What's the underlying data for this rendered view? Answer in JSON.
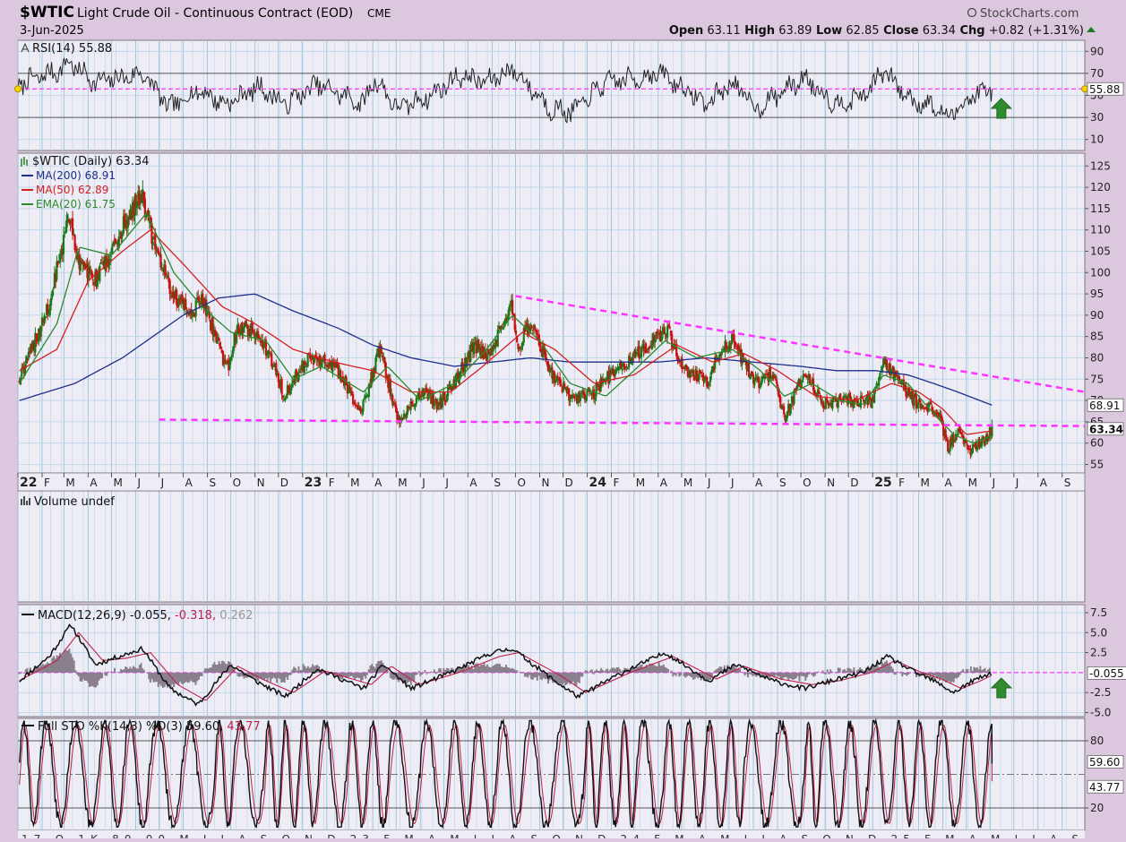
{
  "header": {
    "symbol": "$WTIC",
    "name": "Light Crude Oil - Continuous Contract (EOD)",
    "exchange": "CME",
    "date": "3-Jun-2025",
    "brand": "StockCharts.com",
    "ohlc": [
      {
        "label": "Open",
        "value": "63.11"
      },
      {
        "label": "High",
        "value": "63.89"
      },
      {
        "label": "Low",
        "value": "62.85"
      },
      {
        "label": "Close",
        "value": "63.34"
      },
      {
        "label": "Chg",
        "value": "+0.82 (+1.31%)"
      }
    ]
  },
  "colors": {
    "background": "#dcc8de",
    "plot": "#eeedf6",
    "grid": "#b9d3e6",
    "up": "#1a7a1a",
    "down": "#cc1010",
    "ma200": "#1f2f8a",
    "ma50": "#d42020",
    "ema20": "#2a8a2a",
    "trendline": "#ff33ff",
    "arrow": "#2e8b2e"
  },
  "chart_data": [
    {
      "type": "line",
      "panel": "rsi",
      "title": "RSI(14) 55.88",
      "indicator": "RSI(14)",
      "last_value": 55.88,
      "last_label": "55.88",
      "ylim": [
        0,
        100
      ],
      "yticks": [
        90,
        70,
        50,
        30,
        10
      ],
      "overbought": 70,
      "oversold": 30,
      "reference_line": 55.88,
      "x_range": [
        "2022-01-01",
        "2025-09-30"
      ],
      "x": [
        "2022-01-01",
        "2022-02-20",
        "2022-03-08",
        "2022-04-10",
        "2022-05-15",
        "2022-06-10",
        "2022-07-15",
        "2022-08-20",
        "2022-09-25",
        "2022-11-05",
        "2022-12-10",
        "2023-01-20",
        "2023-03-20",
        "2023-04-03",
        "2023-05-04",
        "2023-06-15",
        "2023-07-20",
        "2023-08-25",
        "2023-09-27",
        "2023-11-15",
        "2023-12-13",
        "2024-01-25",
        "2024-03-10",
        "2024-04-05",
        "2024-06-01",
        "2024-07-05",
        "2024-08-05",
        "2024-09-10",
        "2024-10-07",
        "2024-11-15",
        "2024-12-20",
        "2025-01-15",
        "2025-02-20",
        "2025-03-15",
        "2025-04-08",
        "2025-05-05",
        "2025-06-03"
      ],
      "values": [
        60,
        72,
        80,
        62,
        66,
        70,
        38,
        55,
        42,
        58,
        42,
        60,
        42,
        65,
        38,
        50,
        68,
        62,
        74,
        38,
        35,
        62,
        66,
        70,
        42,
        62,
        38,
        55,
        66,
        42,
        50,
        72,
        45,
        42,
        30,
        48,
        55.88
      ]
    },
    {
      "type": "line",
      "panel": "price",
      "title": "$WTIC (Daily) 63.34",
      "legend": [
        {
          "name": "$WTIC (Daily) 63.34",
          "color": "#1a7a1a"
        },
        {
          "name": "MA(200) 68.91",
          "color": "#1f2f8a"
        },
        {
          "name": "MA(50) 62.89",
          "color": "#d42020"
        },
        {
          "name": "EMA(20) 61.75",
          "color": "#2a8a2a"
        }
      ],
      "ylim": [
        53,
        128
      ],
      "yticks": [
        125,
        120,
        115,
        110,
        105,
        100,
        95,
        90,
        85,
        80,
        75,
        70,
        65,
        60,
        55
      ],
      "x_range": [
        "2022-01-01",
        "2025-09-30"
      ],
      "last_close": 63.34,
      "series": [
        {
          "name": "$WTIC (Daily) 63.34",
          "x": [
            "2022-01-03",
            "2022-02-10",
            "2022-03-08",
            "2022-03-20",
            "2022-04-10",
            "2022-04-25",
            "2022-05-20",
            "2022-06-08",
            "2022-06-25",
            "2022-07-15",
            "2022-08-10",
            "2022-08-25",
            "2022-09-26",
            "2022-10-10",
            "2022-11-08",
            "2022-11-28",
            "2022-12-09",
            "2023-01-05",
            "2023-01-25",
            "2023-02-20",
            "2023-03-17",
            "2023-04-10",
            "2023-05-04",
            "2023-06-05",
            "2023-06-25",
            "2023-07-20",
            "2023-08-10",
            "2023-08-25",
            "2023-09-27",
            "2023-10-05",
            "2023-10-20",
            "2023-11-15",
            "2023-12-12",
            "2024-01-10",
            "2024-02-05",
            "2024-03-01",
            "2024-03-25",
            "2024-04-12",
            "2024-05-02",
            "2024-06-03",
            "2024-06-20",
            "2024-07-05",
            "2024-08-05",
            "2024-08-25",
            "2024-09-10",
            "2024-10-07",
            "2024-10-28",
            "2024-11-15",
            "2024-12-10",
            "2024-12-31",
            "2025-01-15",
            "2025-02-10",
            "2025-03-05",
            "2025-03-25",
            "2025-04-08",
            "2025-04-20",
            "2025-05-05",
            "2025-05-20",
            "2025-06-03"
          ],
          "values": [
            75,
            92,
            114,
            102,
            98,
            103,
            112,
            119,
            106,
            96,
            90,
            94,
            77,
            88,
            85,
            77,
            71,
            79,
            80,
            76,
            67,
            82,
            65,
            72,
            69,
            76,
            83,
            80,
            92,
            83,
            88,
            77,
            70,
            72,
            77,
            80,
            84,
            87,
            78,
            74,
            82,
            84,
            74,
            77,
            66,
            77,
            69,
            70,
            70,
            70,
            79,
            73,
            68,
            68,
            59,
            63,
            58,
            60,
            63.34
          ]
        },
        {
          "name": "MA(200) 68.91",
          "x": [
            "2022-01-03",
            "2022-03-15",
            "2022-05-15",
            "2022-08-01",
            "2022-09-15",
            "2022-11-01",
            "2022-12-20",
            "2023-02-15",
            "2023-04-01",
            "2023-05-20",
            "2023-07-15",
            "2023-09-01",
            "2023-10-20",
            "2023-12-10",
            "2024-02-01",
            "2024-04-01",
            "2024-06-01",
            "2024-08-01",
            "2024-10-01",
            "2024-11-15",
            "2025-01-05",
            "2025-02-15",
            "2025-03-20",
            "2025-04-20",
            "2025-06-03"
          ],
          "values": [
            70,
            74,
            80,
            90,
            94,
            95,
            91,
            87,
            83,
            80,
            78,
            79,
            80,
            79,
            79,
            79,
            80,
            79,
            78,
            77,
            77,
            76,
            74,
            72,
            68.91
          ]
        },
        {
          "name": "MA(50) 62.89",
          "x": [
            "2022-01-03",
            "2022-02-20",
            "2022-04-01",
            "2022-05-15",
            "2022-06-20",
            "2022-08-01",
            "2022-09-20",
            "2022-11-01",
            "2022-12-20",
            "2023-02-10",
            "2023-04-01",
            "2023-05-20",
            "2023-07-10",
            "2023-08-20",
            "2023-10-10",
            "2023-11-20",
            "2024-01-10",
            "2024-03-01",
            "2024-04-25",
            "2024-06-10",
            "2024-07-20",
            "2024-09-01",
            "2024-10-20",
            "2024-12-10",
            "2025-01-25",
            "2025-03-01",
            "2025-04-01",
            "2025-05-01",
            "2025-06-03"
          ],
          "values": [
            77,
            82,
            98,
            105,
            110,
            102,
            92,
            88,
            82,
            79,
            77,
            72,
            72,
            78,
            86,
            82,
            74,
            76,
            83,
            79,
            81,
            77,
            71,
            70,
            74,
            72,
            68,
            62,
            62.89
          ]
        },
        {
          "name": "EMA(20) 61.75",
          "x": [
            "2022-01-03",
            "2022-02-20",
            "2022-03-20",
            "2022-05-01",
            "2022-06-15",
            "2022-07-20",
            "2022-08-25",
            "2022-10-01",
            "2022-11-15",
            "2022-12-20",
            "2023-01-25",
            "2023-03-20",
            "2023-04-20",
            "2023-06-01",
            "2023-07-15",
            "2023-08-25",
            "2023-09-27",
            "2023-11-01",
            "2023-12-10",
            "2024-01-25",
            "2024-03-01",
            "2024-04-10",
            "2024-05-20",
            "2024-07-05",
            "2024-08-10",
            "2024-09-10",
            "2024-10-15",
            "2024-11-20",
            "2024-12-20",
            "2025-01-15",
            "2025-02-15",
            "2025-03-10",
            "2025-04-15",
            "2025-05-10",
            "2025-06-03"
          ],
          "values": [
            74,
            88,
            106,
            104,
            114,
            100,
            92,
            86,
            84,
            75,
            78,
            72,
            78,
            70,
            74,
            82,
            90,
            84,
            74,
            71,
            77,
            84,
            80,
            82,
            77,
            71,
            74,
            70,
            69,
            76,
            74,
            69,
            62,
            60,
            61.75
          ]
        }
      ],
      "trendlines": [
        {
          "name": "resistance",
          "x": [
            "2023-10-01",
            "2025-09-30"
          ],
          "values": [
            94.5,
            72
          ]
        },
        {
          "name": "support",
          "x": [
            "2022-07-01",
            "2025-09-30"
          ],
          "values": [
            65.5,
            64
          ]
        }
      ],
      "value_tags": [
        {
          "label": "68.91",
          "value": 68.91
        },
        {
          "label": "63.34",
          "value": 63.34
        }
      ],
      "x_tick_labels": [
        {
          "label": "22",
          "date": "2022-01-01",
          "year": true
        },
        {
          "label": "F",
          "date": "2022-02-01"
        },
        {
          "label": "M",
          "date": "2022-03-01"
        },
        {
          "label": "A",
          "date": "2022-04-01"
        },
        {
          "label": "M",
          "date": "2022-05-01"
        },
        {
          "label": "J",
          "date": "2022-06-01"
        },
        {
          "label": "J",
          "date": "2022-07-01"
        },
        {
          "label": "A",
          "date": "2022-08-01"
        },
        {
          "label": "S",
          "date": "2022-09-01"
        },
        {
          "label": "O",
          "date": "2022-10-01"
        },
        {
          "label": "N",
          "date": "2022-11-01"
        },
        {
          "label": "D",
          "date": "2022-12-01"
        },
        {
          "label": "23",
          "date": "2023-01-01",
          "year": true
        },
        {
          "label": "F",
          "date": "2023-02-01"
        },
        {
          "label": "M",
          "date": "2023-03-01"
        },
        {
          "label": "A",
          "date": "2023-04-01"
        },
        {
          "label": "M",
          "date": "2023-05-01"
        },
        {
          "label": "J",
          "date": "2023-06-01"
        },
        {
          "label": "J",
          "date": "2023-07-01"
        },
        {
          "label": "A",
          "date": "2023-08-01"
        },
        {
          "label": "S",
          "date": "2023-09-01"
        },
        {
          "label": "O",
          "date": "2023-10-01"
        },
        {
          "label": "N",
          "date": "2023-11-01"
        },
        {
          "label": "D",
          "date": "2023-12-01"
        },
        {
          "label": "24",
          "date": "2024-01-01",
          "year": true
        },
        {
          "label": "F",
          "date": "2024-02-01"
        },
        {
          "label": "M",
          "date": "2024-03-01"
        },
        {
          "label": "A",
          "date": "2024-04-01"
        },
        {
          "label": "M",
          "date": "2024-05-01"
        },
        {
          "label": "J",
          "date": "2024-06-01"
        },
        {
          "label": "J",
          "date": "2024-07-01"
        },
        {
          "label": "A",
          "date": "2024-08-01"
        },
        {
          "label": "S",
          "date": "2024-09-01"
        },
        {
          "label": "O",
          "date": "2024-10-01"
        },
        {
          "label": "N",
          "date": "2024-11-01"
        },
        {
          "label": "D",
          "date": "2024-12-01"
        },
        {
          "label": "25",
          "date": "2025-01-01",
          "year": true
        },
        {
          "label": "F",
          "date": "2025-02-01"
        },
        {
          "label": "M",
          "date": "2025-03-01"
        },
        {
          "label": "A",
          "date": "2025-04-01"
        },
        {
          "label": "M",
          "date": "2025-05-01"
        },
        {
          "label": "J",
          "date": "2025-06-01"
        },
        {
          "label": "J",
          "date": "2025-07-01"
        },
        {
          "label": "A",
          "date": "2025-08-01"
        },
        {
          "label": "S",
          "date": "2025-09-01"
        }
      ]
    },
    {
      "type": "bar",
      "panel": "volume",
      "title": "Volume undef",
      "values": []
    },
    {
      "type": "line",
      "panel": "macd",
      "title": "MACD(12,26,9) -0.055, -0.318, 0.262",
      "title_parts": [
        {
          "text": "MACD(12,26,9) -0.055,",
          "color": "#111111"
        },
        {
          "text": "-0.318,",
          "color": "#c0204a"
        },
        {
          "text": "0.262",
          "color": "#999999"
        }
      ],
      "ylim": [
        -5.5,
        8.5
      ],
      "yticks": [
        7.5,
        5.0,
        2.5,
        -2.5,
        -5.0
      ],
      "last_label": "-0.055",
      "reference_line": -0.055,
      "x_range": [
        "2022-01-01",
        "2025-09-30"
      ],
      "series": [
        {
          "name": "MACD",
          "x": [
            "2022-01-03",
            "2022-02-10",
            "2022-03-10",
            "2022-04-10",
            "2022-05-10",
            "2022-06-10",
            "2022-07-15",
            "2022-08-20",
            "2022-10-01",
            "2022-11-01",
            "2022-12-10",
            "2023-01-20",
            "2023-03-20",
            "2023-04-15",
            "2023-05-20",
            "2023-07-10",
            "2023-09-01",
            "2023-09-27",
            "2023-11-20",
            "2023-12-20",
            "2024-02-15",
            "2024-04-10",
            "2024-06-05",
            "2024-07-10",
            "2024-08-25",
            "2024-10-05",
            "2024-11-10",
            "2024-12-20",
            "2025-01-20",
            "2025-02-25",
            "2025-03-20",
            "2025-04-15",
            "2025-05-10",
            "2025-06-03"
          ],
          "values": [
            -1,
            2,
            6,
            1,
            2,
            3,
            -2,
            -4,
            1,
            -1,
            -3,
            0.5,
            -2,
            1,
            -2,
            0,
            2.5,
            3,
            -1,
            -3,
            0,
            2.5,
            -1,
            1,
            -1,
            -2,
            -1,
            0,
            2,
            0,
            -1,
            -2.5,
            -1,
            -0.055
          ]
        },
        {
          "name": "Signal",
          "x": [
            "2022-01-03",
            "2022-02-20",
            "2022-03-20",
            "2022-04-20",
            "2022-05-20",
            "2022-06-20",
            "2022-07-25",
            "2022-08-30",
            "2022-10-10",
            "2022-11-10",
            "2022-12-20",
            "2023-01-30",
            "2023-03-30",
            "2023-04-25",
            "2023-05-30",
            "2023-07-20",
            "2023-09-10",
            "2023-10-05",
            "2023-11-30",
            "2023-12-30",
            "2024-02-25",
            "2024-04-20",
            "2024-06-15",
            "2024-07-20",
            "2024-09-05",
            "2024-10-15",
            "2024-11-20",
            "2024-12-30",
            "2025-01-30",
            "2025-03-05",
            "2025-03-30",
            "2025-04-25",
            "2025-05-20",
            "2025-06-03"
          ],
          "values": [
            -1,
            1.5,
            5,
            1.5,
            1.8,
            2.5,
            -1.5,
            -3.5,
            0.8,
            -0.8,
            -2.5,
            0.2,
            -1.5,
            0.8,
            -1.5,
            0,
            2,
            2.5,
            -0.5,
            -2.5,
            0,
            2,
            -0.8,
            0.8,
            -0.8,
            -1.5,
            -1,
            0,
            1.5,
            0,
            -0.8,
            -2,
            -1,
            -0.318
          ]
        }
      ]
    },
    {
      "type": "line",
      "panel": "stochastic",
      "title": "Full STO %K(14,3) %D(3) 59.60, 43.77",
      "title_parts": [
        {
          "text": "Full STO %K(14,3) %D(3) 59.60,",
          "color": "#111111"
        },
        {
          "text": "43.77",
          "color": "#c0204a"
        }
      ],
      "ylim": [
        0,
        100
      ],
      "yticks": [
        80,
        20
      ],
      "overbought": 80,
      "oversold": 20,
      "midline": 50,
      "value_tags": [
        {
          "label": "59.60",
          "value": 59.6
        },
        {
          "label": "43.77",
          "value": 43.77
        }
      ],
      "series": [
        {
          "name": "%K",
          "last_value": 59.6
        },
        {
          "name": "%D",
          "last_value": 43.77
        }
      ],
      "x_axis_cutoff_text": "17 O 1K 80 00 M J J A S O N D 23 F M A M J J A S O N D 24 F M A M J J A S O N D 25 F M A M J J A S"
    }
  ]
}
